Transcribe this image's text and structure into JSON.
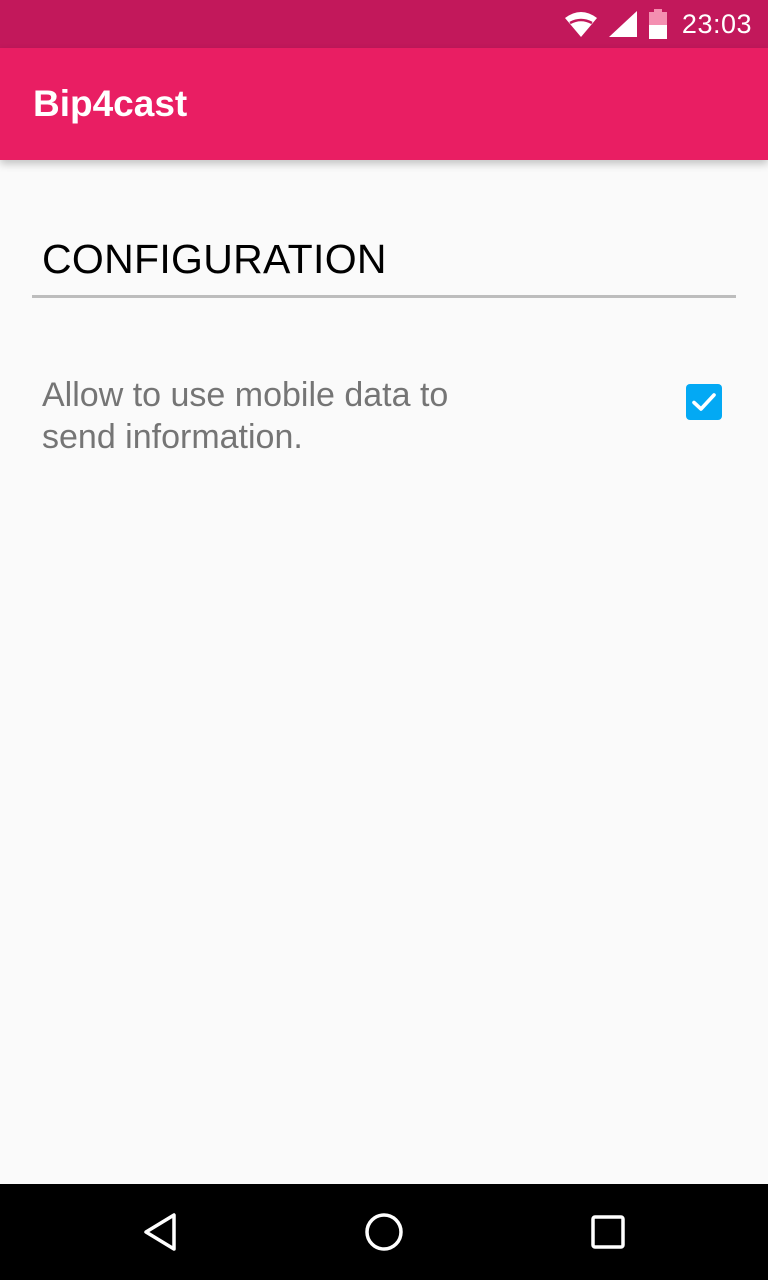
{
  "status_bar": {
    "time": "23:03",
    "icons": [
      "wifi-icon",
      "cell-signal-icon",
      "battery-icon"
    ],
    "color": "#C2185B"
  },
  "app_bar": {
    "title": "Bip4cast",
    "color": "#E91E63"
  },
  "settings": {
    "section_header": "CONFIGURATION",
    "preferences": [
      {
        "label": "Allow to use mobile data to send information.",
        "checked": true,
        "accent_color": "#03A9F4"
      }
    ]
  },
  "nav_bar": {
    "buttons": [
      "back-icon",
      "home-icon",
      "recents-icon"
    ]
  }
}
